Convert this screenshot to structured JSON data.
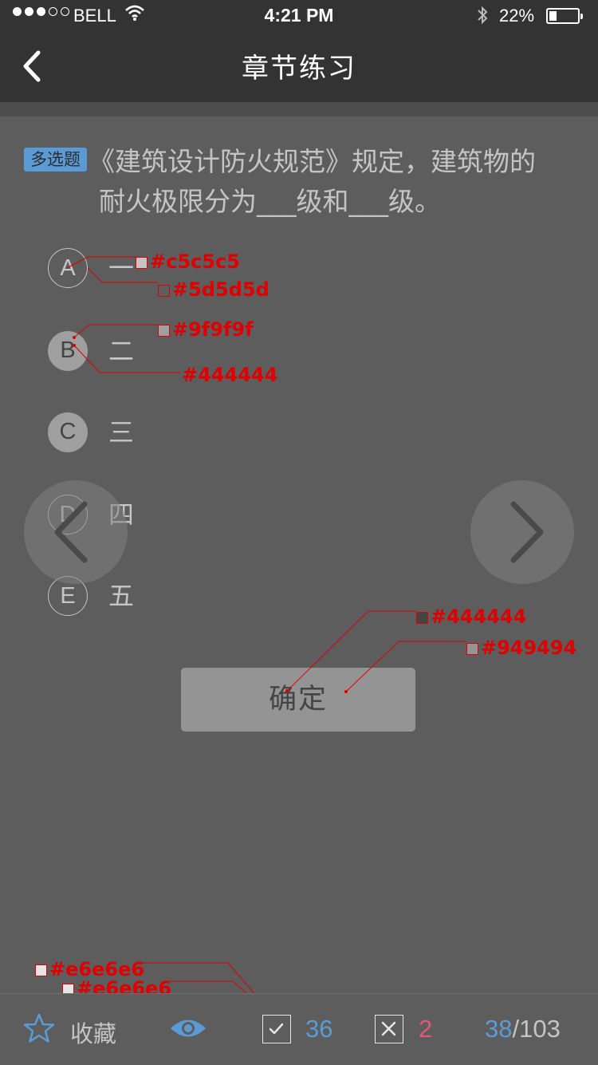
{
  "status_bar": {
    "signal_dots_filled": 3,
    "signal_dots_total": 5,
    "carrier": "BELL",
    "time": "4:21 PM",
    "battery_percent": "22%",
    "battery_level": 0.22
  },
  "nav": {
    "title": "章节练习",
    "back_icon": "chevron-left-icon"
  },
  "question": {
    "type_tag": "多选题",
    "line1": "《建筑设计防火规范》规定，建筑物的",
    "line2": "耐火极限分为___级和___级。"
  },
  "options": [
    {
      "letter": "A",
      "text": "一",
      "state": "outline"
    },
    {
      "letter": "B",
      "text": "二",
      "state": "filled"
    },
    {
      "letter": "C",
      "text": "三",
      "state": "filled"
    },
    {
      "letter": "D",
      "text": "四",
      "state": "outline"
    },
    {
      "letter": "E",
      "text": "五",
      "state": "outline"
    }
  ],
  "pager": {
    "prev_icon": "chevron-left-icon",
    "next_icon": "chevron-right-icon"
  },
  "confirm_label": "确定",
  "annotations": {
    "c5": "#c5c5c5",
    "d5": "#5d5d5d",
    "f9": "#9f9f9f",
    "a44_option": "#444444",
    "a44_button": "#444444",
    "a94": "#949494",
    "e6_a": "#e6e6e6",
    "e6_b": "#e6e6e6"
  },
  "bottom_bar": {
    "favorite_label": "收藏",
    "favorite_icon": "star-icon",
    "view_icon": "eye-icon",
    "correct_icon": "check-box-icon",
    "correct_count": "36",
    "wrong_icon": "x-box-icon",
    "wrong_count": "2",
    "progress_current": "38",
    "progress_separator": "/",
    "progress_total": "103"
  },
  "colors": {
    "background": "#5d5d5d",
    "header": "#333333",
    "text_light": "#c5c5c5",
    "option_fill": "#9f9f9f",
    "option_fill_text": "#444444",
    "button": "#949494",
    "accent_blue": "#5b9bd5",
    "accent_pink": "#e05a78",
    "annotation_red": "#e00000"
  }
}
